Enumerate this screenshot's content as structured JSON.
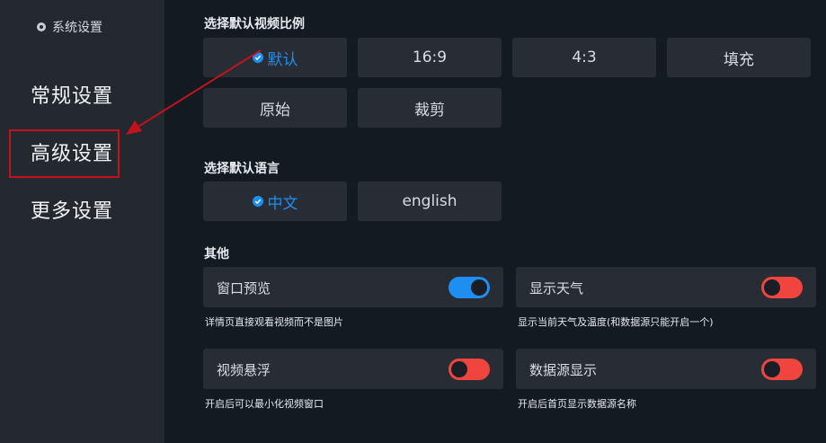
{
  "sidebar": {
    "title": "系统设置",
    "items": [
      {
        "label": "常规设置"
      },
      {
        "label": "高级设置"
      },
      {
        "label": "更多设置"
      }
    ]
  },
  "ratio": {
    "title": "选择默认视频比例",
    "options": [
      {
        "label": "默认",
        "selected": true
      },
      {
        "label": "16:9"
      },
      {
        "label": "4:3"
      },
      {
        "label": "填充"
      },
      {
        "label": "原始"
      },
      {
        "label": "裁剪"
      }
    ]
  },
  "language": {
    "title": "选择默认语言",
    "options": [
      {
        "label": "中文",
        "selected": true
      },
      {
        "label": "english"
      }
    ]
  },
  "other": {
    "title": "其他",
    "items": [
      {
        "label": "窗口预览",
        "on": true,
        "desc": "详情页直接观看视频而不是图片"
      },
      {
        "label": "显示天气",
        "on": false,
        "desc": "显示当前天气及温度(和数据源只能开启一个)"
      },
      {
        "label": "视频悬浮",
        "on": false,
        "desc": "开启后可以最小化视频窗口"
      },
      {
        "label": "数据源显示",
        "on": false,
        "desc": "开启后首页显示数据源名称"
      }
    ]
  },
  "colors": {
    "accent": "#1e8ff0",
    "toggle_off": "#f0453f",
    "annotation": "#c2121b"
  }
}
